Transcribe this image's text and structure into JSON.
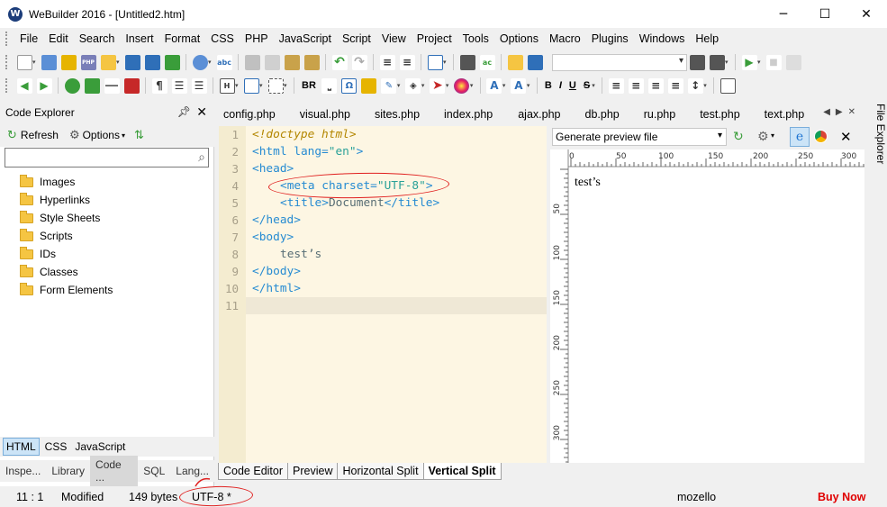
{
  "window": {
    "logo": "W",
    "title": "WeBuilder 2016 - [Untitled2.htm]",
    "controls": [
      "─",
      "☐",
      "✕"
    ]
  },
  "menu": [
    "File",
    "Edit",
    "Search",
    "Insert",
    "Format",
    "CSS",
    "PHP",
    "JavaScript",
    "Script",
    "View",
    "Project",
    "Tools",
    "Options",
    "Macro",
    "Plugins",
    "Windows",
    "Help"
  ],
  "toolbar": {
    "format_text": [
      "BR",
      "B",
      "I",
      "U",
      "S"
    ],
    "colors": {
      "green": "#3a9d3a",
      "blue": "#2f6fb8",
      "yellow": "#e6b400",
      "red": "#c62828",
      "purple": "#6a3aa8",
      "gray": "#7a7a7a"
    }
  },
  "code_explorer": {
    "title": "Code Explorer",
    "pin_icon": "pin-icon",
    "refresh_label": "Refresh",
    "options_label": "Options",
    "search_placeholder": "",
    "tree": [
      "Images",
      "Hyperlinks",
      "Style Sheets",
      "Scripts",
      "IDs",
      "Classes",
      "Form Elements"
    ],
    "lang_tabs": [
      "HTML",
      "CSS",
      "JavaScript"
    ],
    "active_lang": "HTML",
    "panel_tabs": [
      "Inspe...",
      "Library",
      "Code ...",
      "SQL",
      "Lang..."
    ],
    "active_panel": "Code ..."
  },
  "doc_tabs": [
    "config.php",
    "visual.php",
    "sites.php",
    "index.php",
    "ajax.php",
    "db.php",
    "ru.php",
    "test.php",
    "text.php"
  ],
  "editor": {
    "line_numbers": [
      "1",
      "2",
      "3",
      "4",
      "5",
      "6",
      "7",
      "8",
      "9",
      "10",
      "11"
    ],
    "lines": {
      "l1": "<!doctype html>",
      "l2_tag": "<html ",
      "l2_attr": "lang=",
      "l2_val": "\"en\"",
      "l2_end": ">",
      "l3": "<head>",
      "l4_tag": "<meta ",
      "l4_attr": "charset=",
      "l4_val": "\"UTF-8\"",
      "l4_end": ">",
      "l5_open": "<title>",
      "l5_text": "Document",
      "l5_close": "</title>",
      "l6": "</head>",
      "l7": "<body>",
      "l8": "test’s",
      "l9": "</body>",
      "l10": "</html>"
    }
  },
  "preview": {
    "select_value": "Generate preview file",
    "ruler_top": [
      "0",
      "50",
      "100",
      "150",
      "200",
      "250",
      "300"
    ],
    "ruler_left": [
      "50",
      "100",
      "150",
      "200",
      "250",
      "300"
    ],
    "content": "test’s"
  },
  "file_explorer_label": "File Explorer",
  "view_tabs": [
    "Code Editor",
    "Preview",
    "Horizontal Split",
    "Vertical Split"
  ],
  "active_view": "Vertical Split",
  "status": {
    "position": "11 : 1",
    "modified": "Modified",
    "size": "149 bytes",
    "encoding": "UTF-8 *",
    "user": "mozello",
    "buy": "Buy Now"
  },
  "annotation_color": "#e0201f"
}
